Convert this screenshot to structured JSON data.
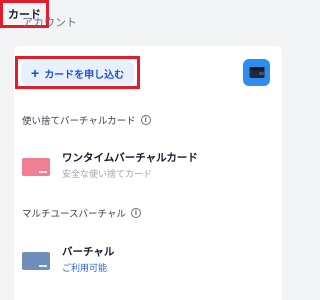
{
  "tabs": {
    "account": "アカウント",
    "card": "カード"
  },
  "apply_button": {
    "label": "カードを申し込む"
  },
  "disposable_section": {
    "title": "使い捨てバーチャルカード"
  },
  "onetime_card": {
    "title": "ワンタイムバーチャルカード",
    "subtitle": "安全な使い捨てカード"
  },
  "multi_section": {
    "title": "マルチユースバーチャル"
  },
  "virtual_card": {
    "title": "バーチャル",
    "status": "ご利用可能"
  },
  "colors": {
    "highlight": "#e11d2a",
    "accent": "#1d4ed8",
    "wallet_bg": "#2f8df0",
    "card_pink": "#ef7f91",
    "card_blue": "#6f8fb8"
  },
  "icons": {
    "plus": "plus-icon",
    "wallet": "wallet-icon",
    "info": "info-icon"
  }
}
